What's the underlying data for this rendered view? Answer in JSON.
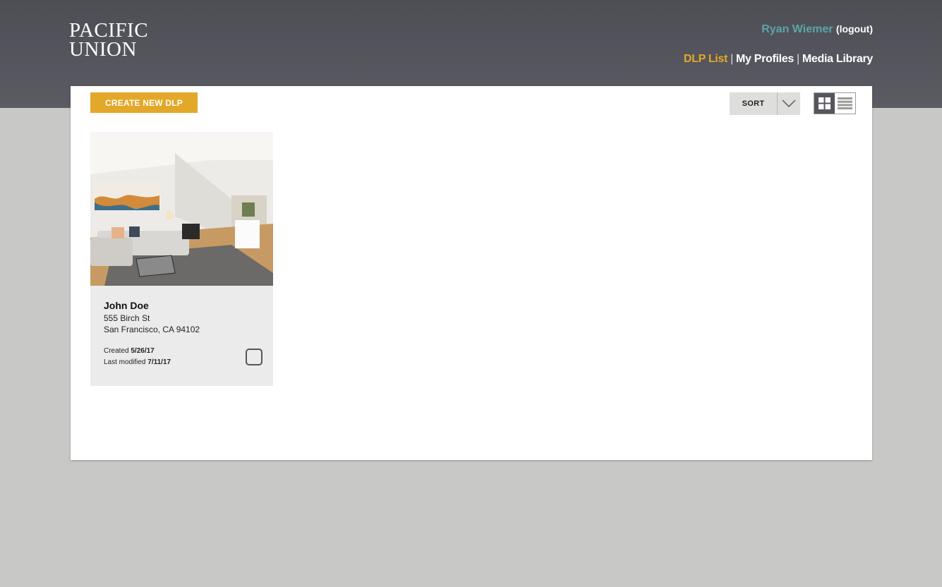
{
  "header": {
    "logo_line1": "PACIFIC",
    "logo_line2": "UNION",
    "user_name": "Ryan Wiemer",
    "logout_label": "(logout)",
    "nav": {
      "dlp_list": "DLP List",
      "my_profiles": "My Profiles",
      "media_library": "Media Library",
      "separator": "|"
    }
  },
  "toolbar": {
    "create_label": "CREATE NEW DLP",
    "sort_label": "SORT",
    "view_modes": [
      "grid-icon",
      "list-icon"
    ],
    "active_view": "grid"
  },
  "cards": [
    {
      "name": "John Doe",
      "address_line1": "555 Birch St",
      "address_line2": "San Francisco, CA 94102",
      "created_label": "Created",
      "created_date": "5/26/17",
      "modified_label": "Last modified",
      "modified_date": "7/11/17",
      "checked": false
    }
  ],
  "colors": {
    "header_bg": "#55565c",
    "accent": "#e3a829",
    "user_name": "#5aa5a9",
    "page_bg": "#c8c8c6"
  }
}
